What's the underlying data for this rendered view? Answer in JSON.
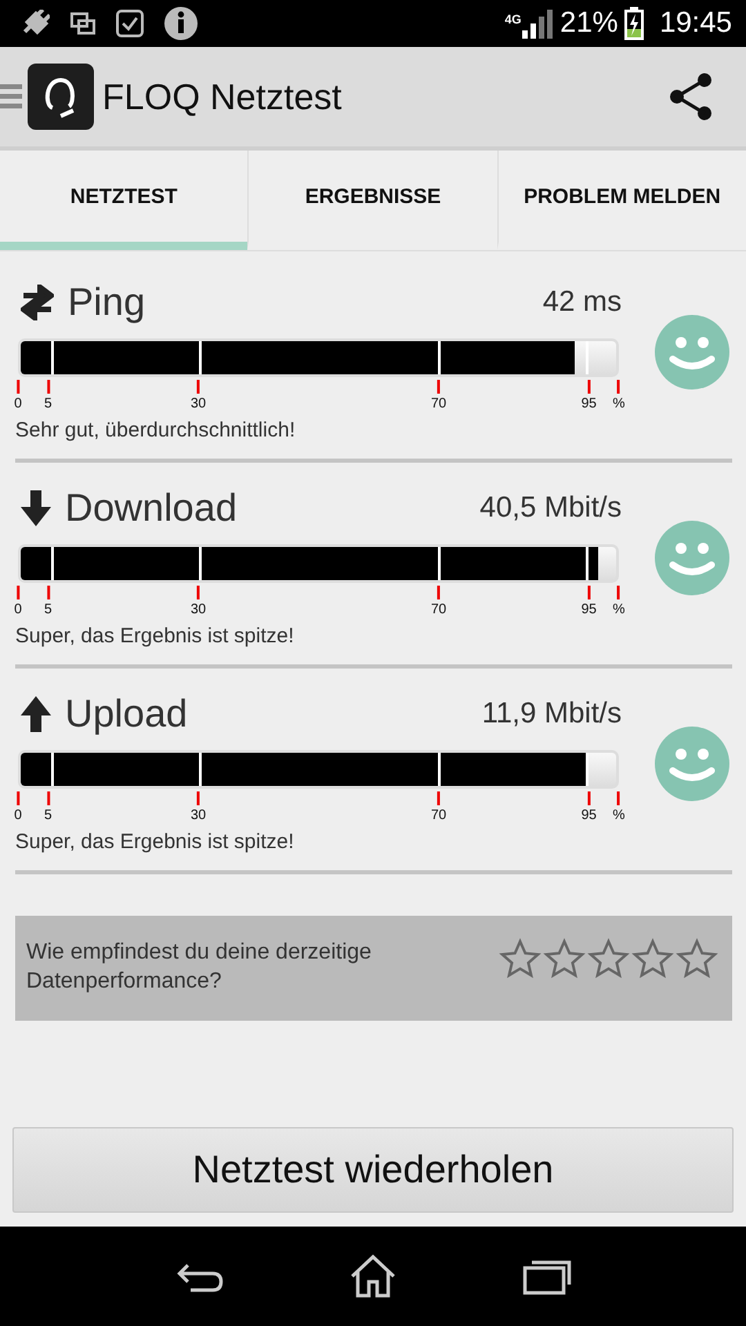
{
  "status_bar": {
    "network": "4G",
    "battery": "21%",
    "time": "19:45"
  },
  "app_bar": {
    "title": "FLOQ Netztest"
  },
  "tabs": [
    {
      "label": "NETZTEST",
      "selected": true
    },
    {
      "label": "ERGEBNISSE",
      "selected": false
    },
    {
      "label": "PROBLEM MELDEN",
      "selected": false
    }
  ],
  "meters": [
    {
      "kind": "ping",
      "name": "Ping",
      "reading": "42 ms",
      "level": 0.93,
      "scale": [
        "0",
        "5",
        "30",
        "70",
        "95",
        "%"
      ],
      "verdict": "Sehr gut, überdurchschnittlich!"
    },
    {
      "kind": "download",
      "name": "Download",
      "reading": "40,5 Mbit/s",
      "level": 0.97,
      "scale": [
        "0",
        "5",
        "30",
        "70",
        "95",
        "%"
      ],
      "verdict": "Super, das Ergebnis ist spitze!"
    },
    {
      "kind": "upload",
      "name": "Upload",
      "reading": "11,9 Mbit/s",
      "level": 0.95,
      "scale": [
        "0",
        "5",
        "30",
        "70",
        "95",
        "%"
      ],
      "verdict": "Super, das Ergebnis ist spitze!"
    }
  ],
  "rating": {
    "question": "Wie empfindest du deine derzeitige Datenperformance?",
    "stars": 0
  },
  "repeat_button": "Netztest wiederholen"
}
